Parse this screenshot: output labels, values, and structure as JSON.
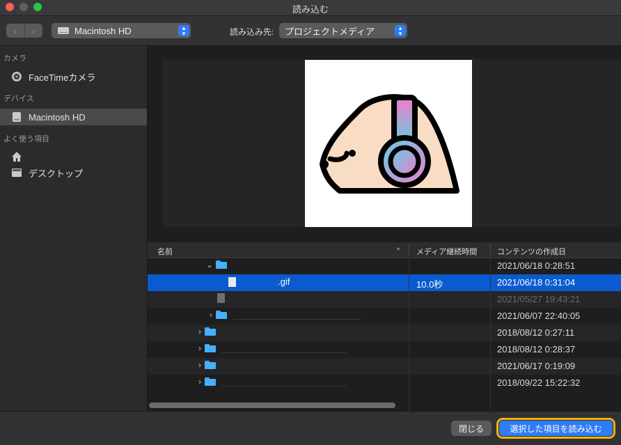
{
  "window": {
    "title": "読み込む"
  },
  "toolbar": {
    "location": "Macintosh HD",
    "destination_label": "読み込み先:",
    "destination": "プロジェクトメディア"
  },
  "sidebar": {
    "sections": [
      {
        "header": "カメラ",
        "items": [
          {
            "label": "FaceTimeカメラ",
            "icon": "camera-icon"
          }
        ]
      },
      {
        "header": "デバイス",
        "items": [
          {
            "label": "Macintosh HD",
            "icon": "hard-drive-icon",
            "selected": true
          }
        ]
      },
      {
        "header": "よく使う項目",
        "items": [
          {
            "label": "",
            "icon": "home-icon"
          },
          {
            "label": "デスクトップ",
            "icon": "desktop-icon"
          }
        ]
      }
    ]
  },
  "table": {
    "columns": {
      "name": "名前",
      "duration": "メディア継続時間",
      "created": "コンテンツの作成日"
    },
    "rows": [
      {
        "name": "",
        "type": "folder",
        "expanded": true,
        "depth": 2,
        "duration": "",
        "created": "2021/06/18 0:28:51"
      },
      {
        "name": ".gif",
        "type": "file",
        "depth": 3,
        "duration": "10.0秒",
        "created": "2021/06/18 0:31:04",
        "selected": true
      },
      {
        "name": "",
        "type": "file",
        "depth": 2,
        "duration": "",
        "created": "2021/05/27 19:43:21",
        "dim": true
      },
      {
        "name": "",
        "type": "folder",
        "depth": 2,
        "duration": "",
        "created": "2021/06/07 22:40:05"
      },
      {
        "name": "",
        "type": "folder",
        "depth": 1,
        "duration": "",
        "created": "2018/08/12 0:27:11"
      },
      {
        "name": "",
        "type": "folder",
        "depth": 1,
        "duration": "",
        "created": "2018/08/12 0:28:37"
      },
      {
        "name": "",
        "type": "folder",
        "depth": 1,
        "duration": "",
        "created": "2021/06/17 0:19:09"
      },
      {
        "name": "",
        "type": "folder",
        "depth": 1,
        "duration": "",
        "created": "2018/09/22 15:22:32"
      }
    ]
  },
  "footer": {
    "close_label": "閉じる",
    "import_label": "選択した項目を読み込む"
  },
  "colors": {
    "selection": "#0a5bcf",
    "accent": "#2f7cf6",
    "highlight_outline": "#f4b400"
  }
}
